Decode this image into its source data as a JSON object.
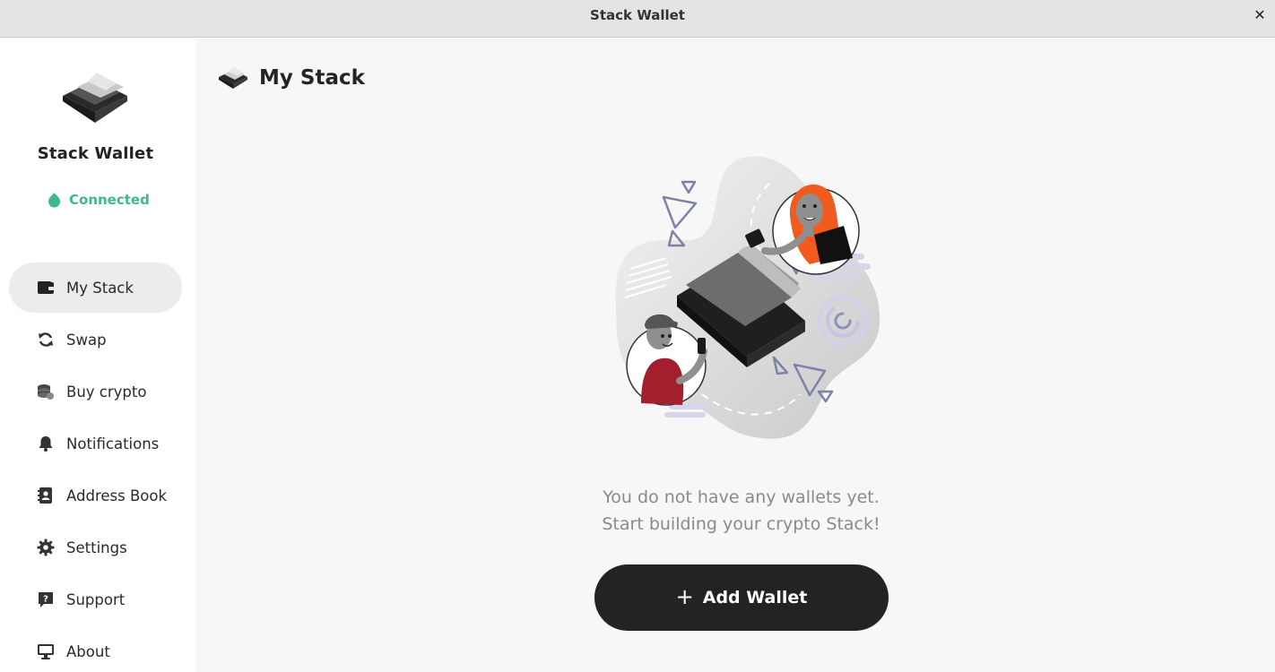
{
  "window": {
    "title": "Stack Wallet",
    "close_glyph": "✕"
  },
  "sidebar": {
    "brand_name": "Stack Wallet",
    "status": {
      "label": "Connected",
      "icon": "connected-status-icon",
      "color": "#3eb98a"
    },
    "items": [
      {
        "label": "My Stack",
        "icon": "wallet-icon",
        "active": true
      },
      {
        "label": "Swap",
        "icon": "swap-icon",
        "active": false
      },
      {
        "label": "Buy crypto",
        "icon": "coins-icon",
        "active": false
      },
      {
        "label": "Notifications",
        "icon": "bell-icon",
        "active": false
      },
      {
        "label": "Address Book",
        "icon": "address-book-icon",
        "active": false
      },
      {
        "label": "Settings",
        "icon": "gear-icon",
        "active": false
      },
      {
        "label": "Support",
        "icon": "support-icon",
        "active": false
      },
      {
        "label": "About",
        "icon": "monitor-icon",
        "active": false
      }
    ]
  },
  "main": {
    "title": "My Stack",
    "empty_state": {
      "line1": "You do not have any wallets yet.",
      "line2": "Start building your crypto Stack!"
    },
    "add_button": {
      "icon_glyph": "+",
      "label": "Add Wallet"
    }
  },
  "colors": {
    "accent_dark": "#232323",
    "connected": "#3eb98a",
    "active_nav_bg": "#ececec"
  }
}
